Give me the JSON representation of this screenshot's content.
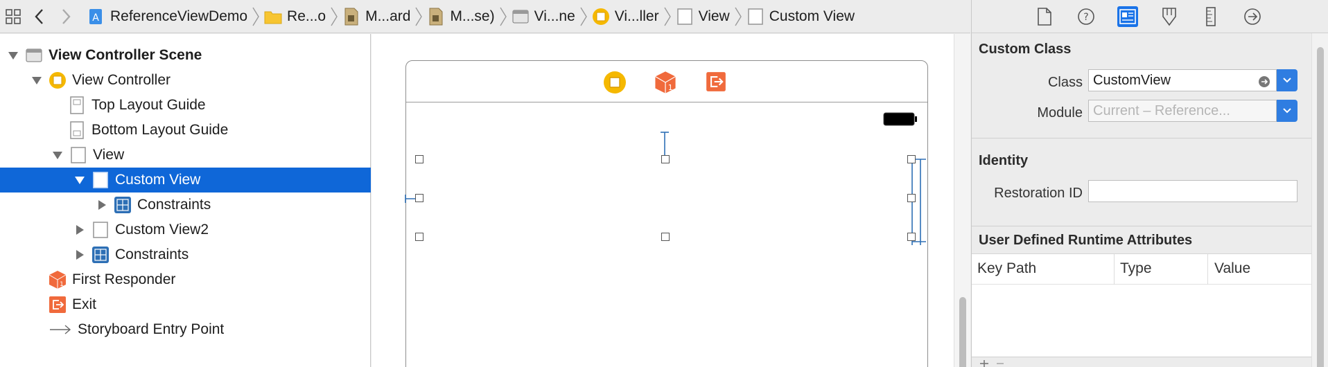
{
  "jumpbar": {
    "crumbs": [
      {
        "label": "ReferenceViewDemo",
        "icon": "xcode-project-icon"
      },
      {
        "label": "Re...o",
        "icon": "folder-icon"
      },
      {
        "label": "M...ard",
        "icon": "storyboard-icon"
      },
      {
        "label": "M...se)",
        "icon": "storyboard-icon"
      },
      {
        "label": "Vi...ne",
        "icon": "scene-icon"
      },
      {
        "label": "Vi...ller",
        "icon": "view-controller-icon"
      },
      {
        "label": "View",
        "icon": "view-icon"
      },
      {
        "label": "Custom View",
        "icon": "view-icon"
      }
    ]
  },
  "outline": {
    "scene": "View Controller Scene",
    "items": [
      {
        "label": "View Controller"
      },
      {
        "label": "Top Layout Guide"
      },
      {
        "label": "Bottom Layout Guide"
      },
      {
        "label": "View"
      },
      {
        "label": "Custom View"
      },
      {
        "label": "Constraints"
      },
      {
        "label": "Custom View2"
      },
      {
        "label": "Constraints"
      },
      {
        "label": "First Responder"
      },
      {
        "label": "Exit"
      },
      {
        "label": "Storyboard Entry Point"
      }
    ]
  },
  "inspector": {
    "custom_class": {
      "title": "Custom Class",
      "class_label": "Class",
      "class_value": "CustomView",
      "module_label": "Module",
      "module_placeholder": "Current – Reference..."
    },
    "identity": {
      "title": "Identity",
      "restoration_label": "Restoration ID",
      "restoration_value": ""
    },
    "runtime_attributes": {
      "title": "User Defined Runtime Attributes",
      "columns": [
        "Key Path",
        "Type",
        "Value"
      ]
    }
  },
  "colors": {
    "selection": "#0f67d8",
    "accent": "#1a73e8",
    "scene_yellow": "#f5b800",
    "responder_orange": "#f06a3c",
    "constraint_blue": "#2d6fb5"
  }
}
